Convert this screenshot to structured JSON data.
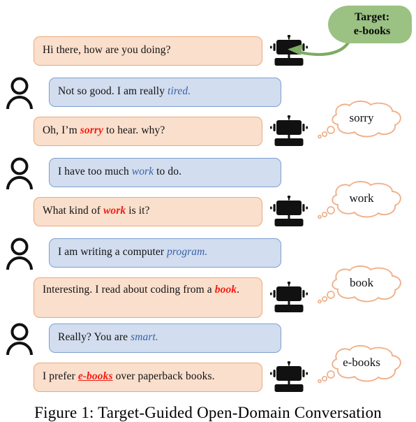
{
  "figure": {
    "caption": "Figure 1:  Target-Guided Open-Domain Conversation",
    "target_callout": {
      "line1": "Target:",
      "line2": "e-books",
      "bubble_color": "#9bc183",
      "arrow_color": "#7eab62"
    },
    "colors": {
      "bot_bubble_fill": "#fadfcd",
      "bot_bubble_border": "#eca877",
      "user_bubble_fill": "#d2ddef",
      "user_bubble_border": "#7c9fd0",
      "keyword_blue": "#3a62a8",
      "keyword_red": "#f41d12",
      "cloud_stroke": "#f0b08a"
    },
    "turns": [
      {
        "speaker": "bot",
        "icon": "robot-icon",
        "text_prefix": "Hi there, how are you doing?",
        "keyword": "",
        "keyword_style": "",
        "text_suffix": "",
        "cloud": null
      },
      {
        "speaker": "user",
        "icon": "person-icon",
        "text_prefix": "Not so good. I am really ",
        "keyword": "tired.",
        "keyword_style": "blue",
        "text_suffix": "",
        "cloud": null
      },
      {
        "speaker": "bot",
        "icon": "robot-icon",
        "text_prefix": "Oh, I’m ",
        "keyword": "sorry",
        "keyword_style": "red",
        "text_suffix": " to hear. why?",
        "cloud": "sorry"
      },
      {
        "speaker": "user",
        "icon": "person-icon",
        "text_prefix": "I have too much ",
        "keyword": "work",
        "keyword_style": "blue",
        "text_suffix": " to do.",
        "cloud": null
      },
      {
        "speaker": "bot",
        "icon": "robot-icon",
        "text_prefix": "What kind of ",
        "keyword": "work",
        "keyword_style": "red",
        "text_suffix": " is it?",
        "cloud": "work"
      },
      {
        "speaker": "user",
        "icon": "person-icon",
        "text_prefix": "I am writing a computer ",
        "keyword": "program.",
        "keyword_style": "blue",
        "text_suffix": "",
        "cloud": null
      },
      {
        "speaker": "bot",
        "icon": "robot-icon",
        "text_prefix": "Interesting. I read about coding from a ",
        "keyword": "book",
        "keyword_style": "red",
        "text_suffix": ".",
        "cloud": "book"
      },
      {
        "speaker": "user",
        "icon": "person-icon",
        "text_prefix": "Really? You are ",
        "keyword": "smart.",
        "keyword_style": "blue",
        "text_suffix": "",
        "cloud": null
      },
      {
        "speaker": "bot",
        "icon": "robot-icon",
        "text_prefix": "I prefer ",
        "keyword": "e-books",
        "keyword_style": "red-underline",
        "text_suffix": " over paperback books.",
        "cloud": "e-books"
      }
    ]
  }
}
